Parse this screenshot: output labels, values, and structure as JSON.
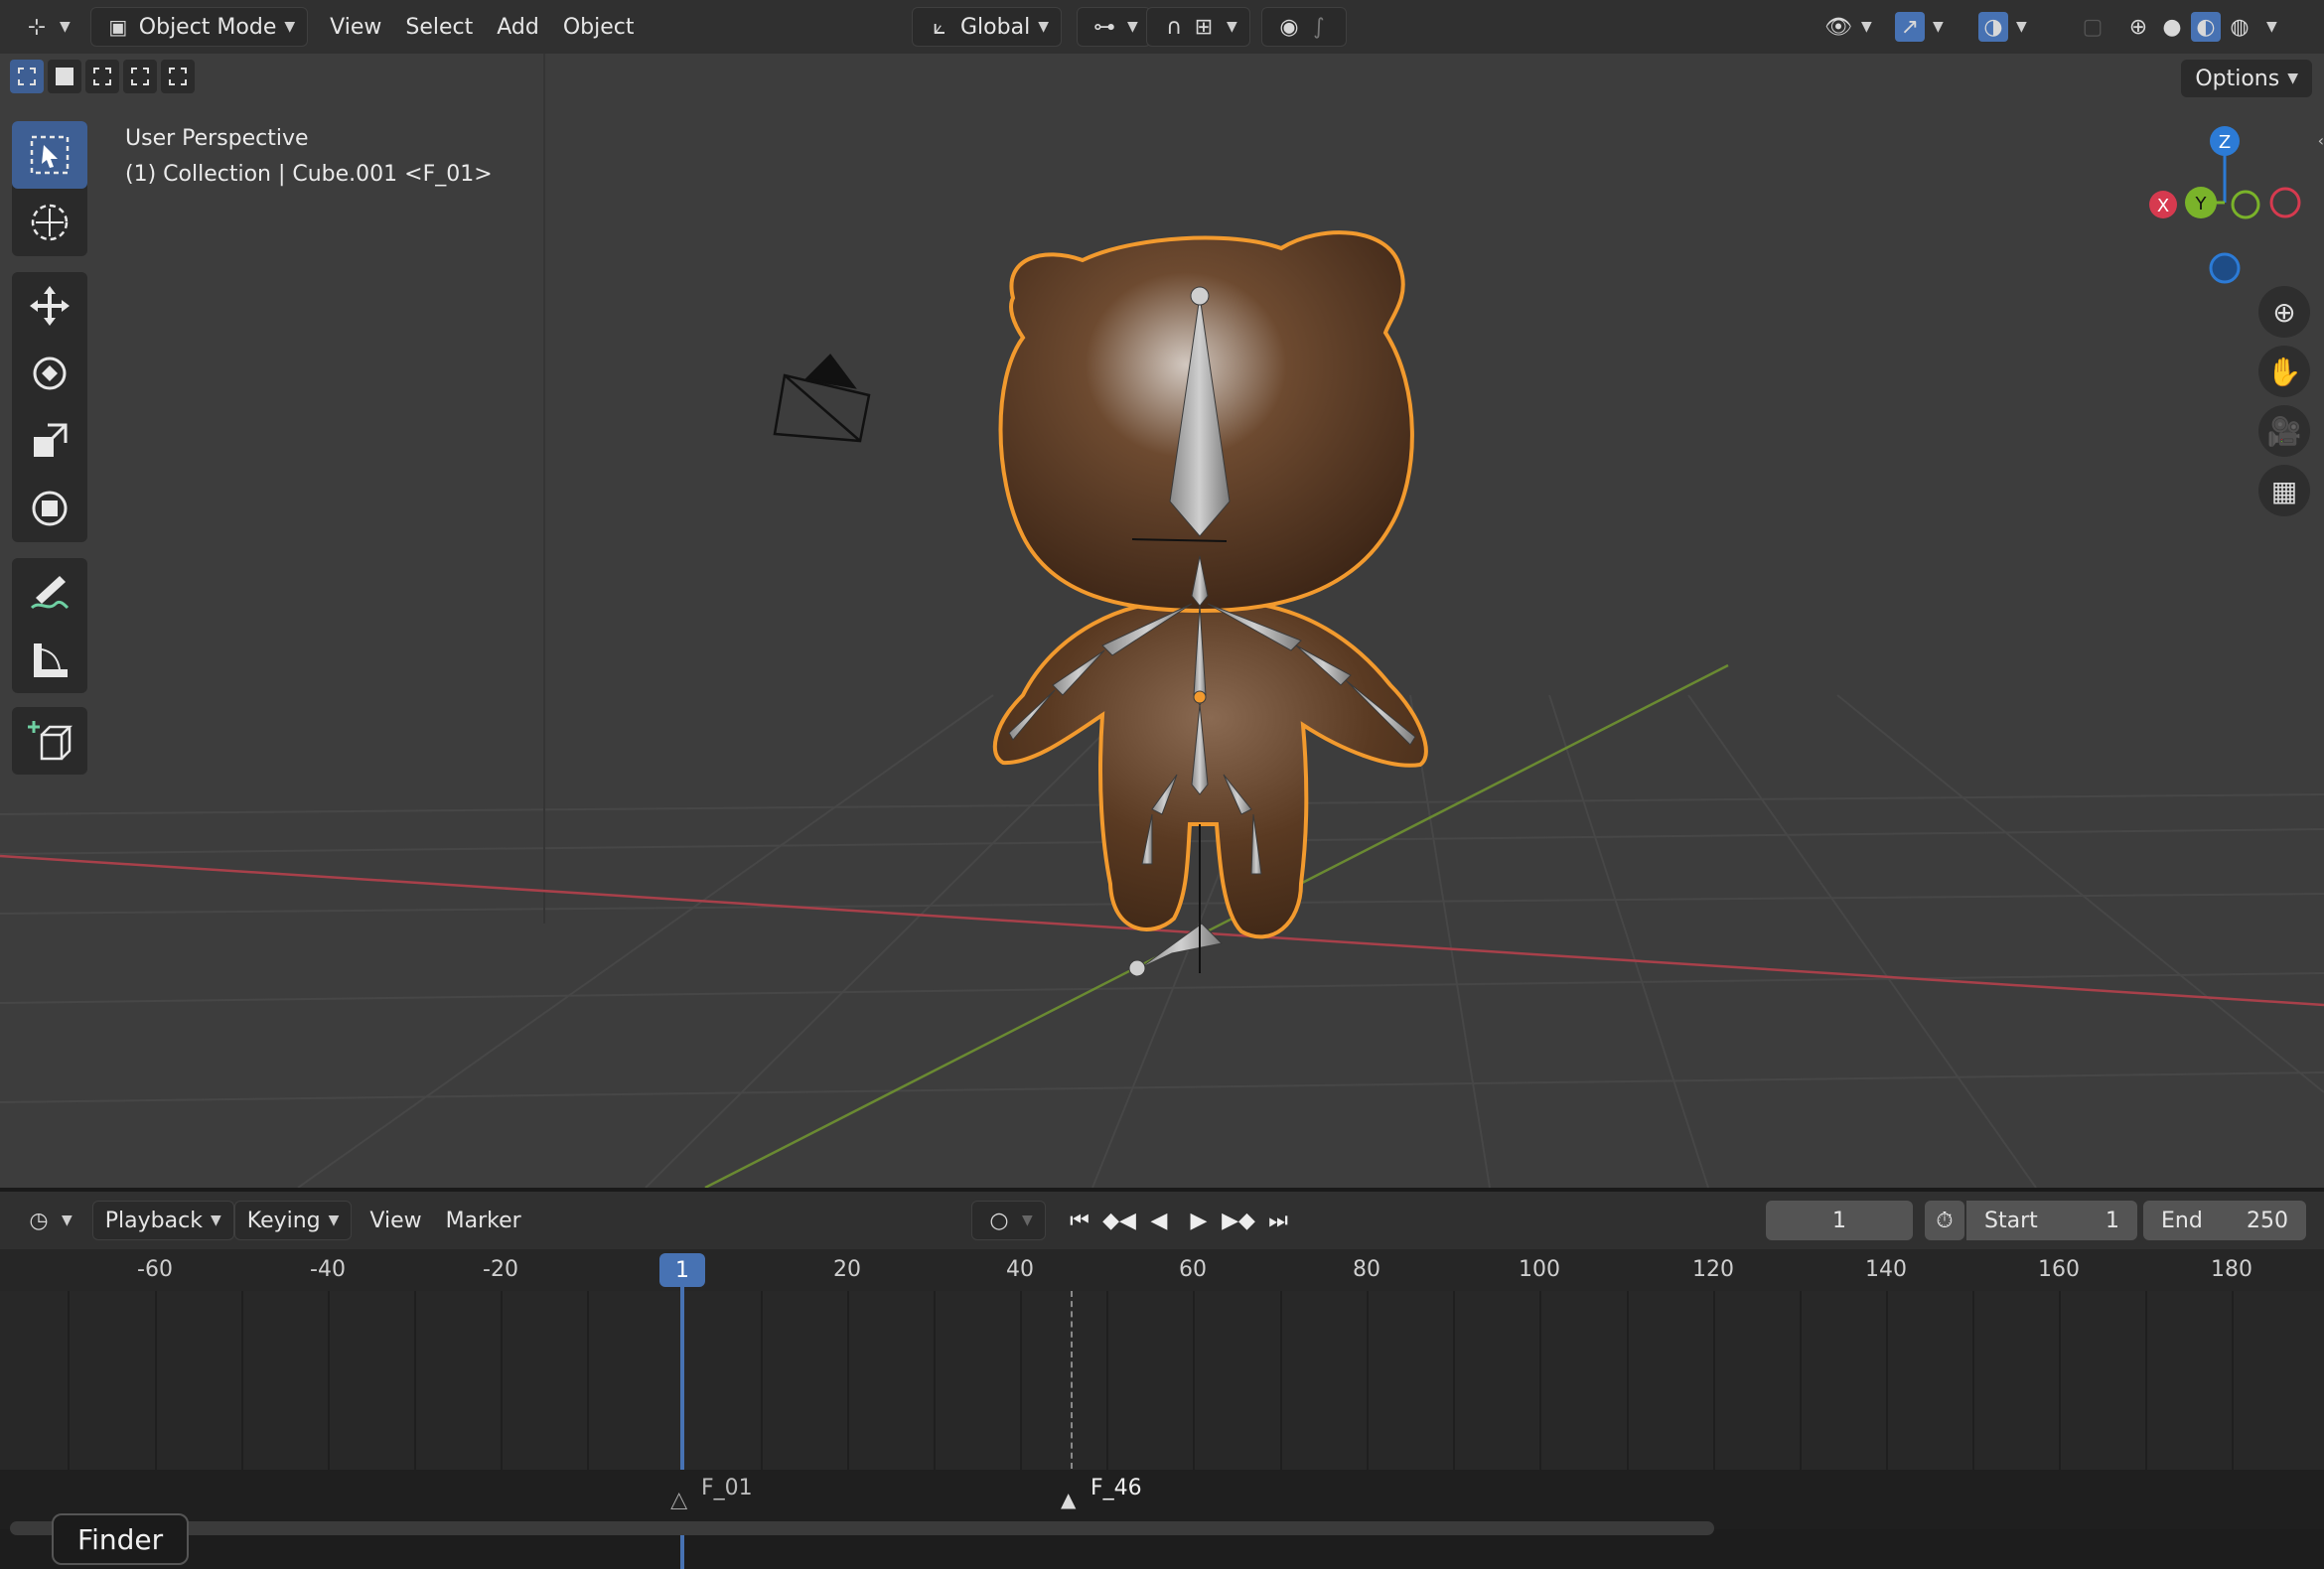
{
  "header": {
    "mode_label": "Object Mode",
    "menus": [
      "View",
      "Select",
      "Add",
      "Object"
    ],
    "transform_orientation": "Global",
    "options_label": "Options"
  },
  "viewport": {
    "perspective_label": "User Perspective",
    "collection_label": "(1) Collection | Cube.001 <F_01>"
  },
  "gizmo": {
    "z_label": "Z",
    "y_label": "Y",
    "x_label": "X"
  },
  "timeline": {
    "menus": [
      "Playback",
      "Keying",
      "View",
      "Marker"
    ],
    "current_frame": "1",
    "start_label": "Start",
    "start_value": "1",
    "end_label": "End",
    "end_value": "250",
    "ruler_ticks": [
      "-60",
      "-40",
      "-20",
      "20",
      "40",
      "60",
      "80",
      "100",
      "120",
      "140",
      "160",
      "180"
    ],
    "playhead_label": "1",
    "marker_1": "F_01",
    "marker_2": "F_46"
  },
  "tooltip": {
    "finder_label": "Finder"
  },
  "colors": {
    "accent": "#4772b3",
    "selection_outline": "#f29a2e",
    "x_axis": "#d63a4f",
    "y_axis": "#7ab32a",
    "z_axis": "#2c7bd6"
  }
}
